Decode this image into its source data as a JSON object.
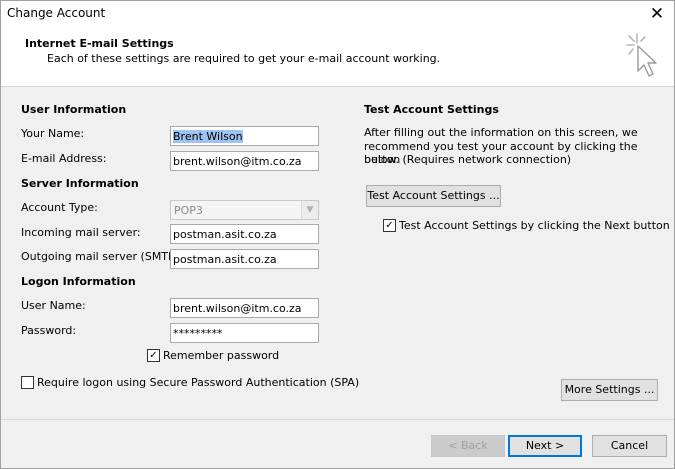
{
  "window": {
    "title": "Change Account",
    "close_symbol": "✕"
  },
  "header": {
    "title": "Internet E-mail Settings",
    "subtitle": "Each of these settings are required to get your e-mail account working."
  },
  "user_info": {
    "heading": "User Information",
    "name_label": "Your Name:",
    "name_value": "Brent Wilson",
    "email_label": "E-mail Address:",
    "email_value": "brent.wilson@itm.co.za"
  },
  "server_info": {
    "heading": "Server Information",
    "account_type_label": "Account Type:",
    "account_type_value": "POP3",
    "incoming_label": "Incoming mail server:",
    "incoming_value": "postman.asit.co.za",
    "outgoing_label": "Outgoing mail server (SMTP):",
    "outgoing_value": "postman.asit.co.za"
  },
  "logon_info": {
    "heading": "Logon Information",
    "username_label": "User Name:",
    "username_value": "brent.wilson@itm.co.za",
    "password_label": "Password:",
    "password_value": "*********",
    "remember_label": "Remember password",
    "remember_checked": true,
    "spa_label": "Require logon using Secure Password Authentication (SPA)",
    "spa_checked": false
  },
  "test_settings": {
    "heading": "Test Account Settings",
    "description_line1": "After filling out the information on this screen, we",
    "description_line2": "recommend you test your account by clicking the button",
    "description_line3": "below. (Requires network connection)",
    "test_button": "Test Account Settings ...",
    "next_test_label": "Test Account Settings by clicking the Next button",
    "next_test_checked": true
  },
  "buttons": {
    "more_settings": "More Settings ...",
    "back": "< Back",
    "next": "Next >",
    "cancel": "Cancel"
  },
  "icons": {
    "wizard": "wizard-cursor-icon",
    "checkmark": "✓"
  }
}
